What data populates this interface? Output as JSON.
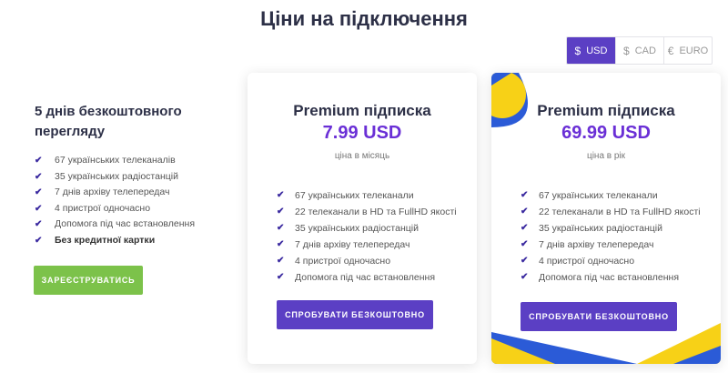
{
  "page": {
    "title": "Ціни на підключення"
  },
  "currency": {
    "options": [
      {
        "symbol": "$",
        "label": "USD",
        "active": true
      },
      {
        "symbol": "$",
        "label": "CAD",
        "active": false
      },
      {
        "symbol": "€",
        "label": "EURO",
        "active": false
      }
    ]
  },
  "free_trial": {
    "title": "5 днів безкоштовного перегляду",
    "features": [
      "67 українських телеканалів",
      "35 українських радіостанцій",
      "7 днів архіву телепередач",
      "4 пристрої одночасно",
      "Допомога під час встановлення",
      "Без кредитної картки"
    ],
    "button": "ЗАРЕЄСТРУВАТИСЬ"
  },
  "plans": [
    {
      "title": "Premium підписка",
      "price": "7.99 USD",
      "period": "ціна в місяць",
      "features": [
        "67 українських телеканали",
        "22 телеканали в HD та FullHD якості",
        "35 українських радіостанцій",
        "7 днів архіву телепередач",
        "4 пристрої одночасно",
        "Допомога під час встановлення"
      ],
      "button": "СПРОБУВАТИ БЕЗКОШТОВНО"
    },
    {
      "title": "Premium підписка",
      "price": "69.99 USD",
      "period": "ціна в рік",
      "features": [
        "67 українських телеканали",
        "22 телеканали в HD та FullHD якості",
        "35 українських радіостанцій",
        "7 днів архіву телепередач",
        "4 пристрої одночасно",
        "Допомога під час встановлення"
      ],
      "button": "СПРОБУВАТИ БЕЗКОШТОВНО"
    }
  ],
  "colors": {
    "accent": "#5b3fc4",
    "price": "#6a2fd6",
    "register": "#7cc24a",
    "flag_blue": "#2b5bd7",
    "flag_yellow": "#f7d117"
  }
}
